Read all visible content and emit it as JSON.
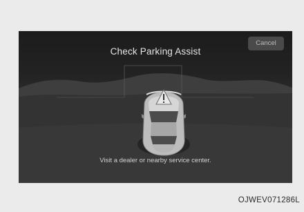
{
  "screen": {
    "title": "Check Parking Assist",
    "cancel_label": "Cancel",
    "message": "Visit a dealer or nearby service center."
  },
  "footer": {
    "image_code": "OJWEV071286L"
  },
  "icons": {
    "vehicle": "car-top-view-icon",
    "warning": "warning-triangle-icon"
  },
  "colors": {
    "screen_background": "#262626",
    "text_primary": "#e6e6e6",
    "button_background": "#4a4a4a"
  }
}
